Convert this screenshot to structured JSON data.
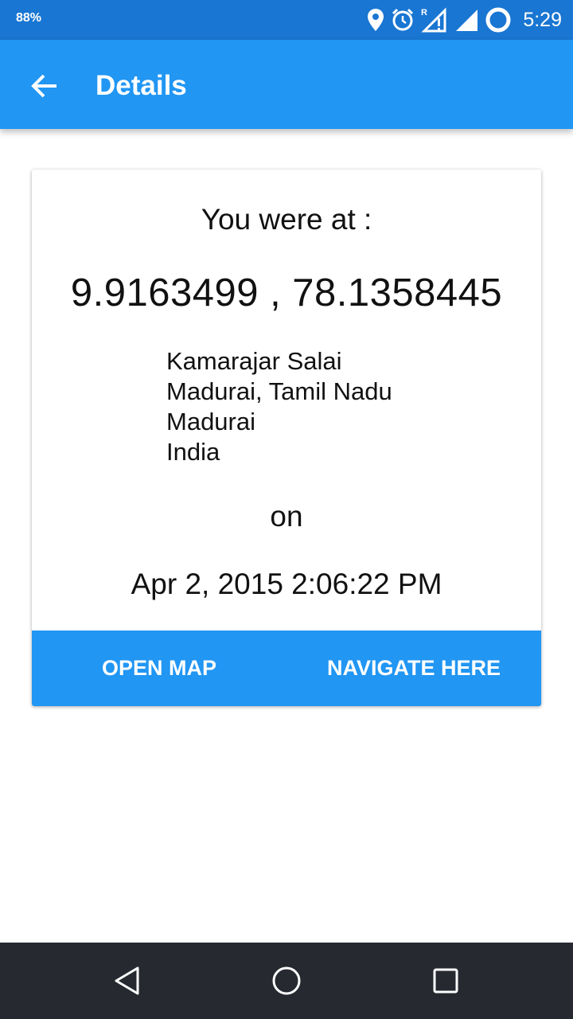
{
  "status_bar": {
    "battery_percent": "88%",
    "time": "5:29",
    "icons": [
      "location-icon",
      "alarm-icon",
      "roaming-signal-icon",
      "signal-icon",
      "battery-icon"
    ]
  },
  "app_bar": {
    "title": "Details",
    "back_icon": "arrow-back-icon"
  },
  "card": {
    "intro": "You were at :",
    "coordinates": "9.9163499 , 78.1358445",
    "address_lines": [
      "Kamarajar Salai",
      "Madurai, Tamil Nadu",
      "Madurai",
      "India"
    ],
    "on_label": "on",
    "timestamp": "Apr 2, 2015 2:06:22 PM",
    "buttons": {
      "open_map": "OPEN MAP",
      "navigate_here": "NAVIGATE HERE"
    }
  },
  "nav_bar": {
    "icons": [
      "nav-back-icon",
      "nav-home-icon",
      "nav-recents-icon"
    ]
  },
  "colors": {
    "status_bar": "#1976d2",
    "primary": "#2196f3",
    "nav_bar": "#262a30",
    "text": "#111111"
  }
}
